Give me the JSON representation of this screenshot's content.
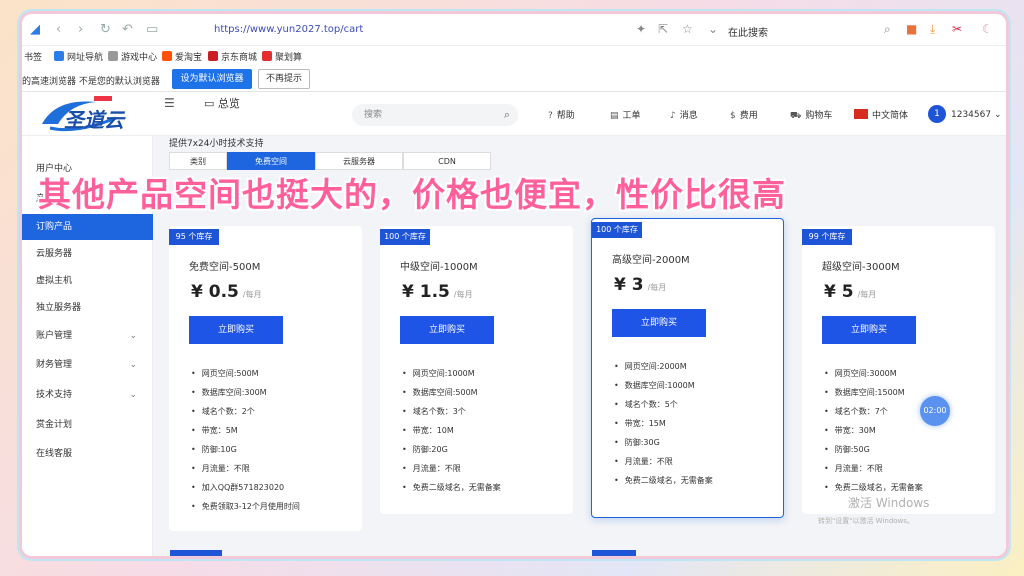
{
  "browser": {
    "url": "https://www.yun2027.top/cart",
    "search_engine_label": "在此搜索"
  },
  "bookmarks": [
    {
      "label": "书签",
      "color": "#ffffff"
    },
    {
      "label": "网址导航",
      "color": "#2b7de9"
    },
    {
      "label": "游戏中心",
      "color": "#999999"
    },
    {
      "label": "爱淘宝",
      "color": "#ff5000"
    },
    {
      "label": "京东商城",
      "color": "#c71f26"
    },
    {
      "label": "聚划算",
      "color": "#e52e2e"
    }
  ],
  "notice": {
    "text": "的高速浏览器 不是您的默认浏览器",
    "set_default_label": "设为默认浏览器",
    "no_ask_label": "不再提示"
  },
  "header": {
    "logo_text": "圣道云",
    "overview_label": "总览",
    "search_placeholder": "搜索",
    "nav": [
      {
        "icon": "?",
        "label": "帮助"
      },
      {
        "icon": "▤",
        "label": "工单"
      },
      {
        "icon": "♪",
        "label": "消息"
      },
      {
        "icon": "$",
        "label": "费用"
      },
      {
        "icon": "⛟",
        "label": "购物车"
      }
    ],
    "language": "中文简体",
    "user_badge": "1",
    "user_id": "1234567"
  },
  "sidebar": {
    "items": [
      {
        "label": "用户中心",
        "active": false,
        "caret": false
      },
      {
        "label": "产品",
        "active": false,
        "caret": false
      },
      {
        "label": "订购产品",
        "active": true,
        "caret": false
      },
      {
        "label": "云服务器",
        "active": false,
        "caret": false
      },
      {
        "label": "虚拟主机",
        "active": false,
        "caret": false
      },
      {
        "label": "独立服务器",
        "active": false,
        "caret": false
      },
      {
        "label": "账户管理",
        "active": false,
        "caret": true
      },
      {
        "label": "财务管理",
        "active": false,
        "caret": true
      },
      {
        "label": "技术支持",
        "active": false,
        "caret": true
      },
      {
        "label": "赏金计划",
        "active": false,
        "caret": false
      },
      {
        "label": "在线客服",
        "active": false,
        "caret": false
      }
    ]
  },
  "content": {
    "support_text": "提供7x24小时技术支持",
    "tabs": [
      {
        "label": "类别",
        "active": false
      },
      {
        "label": "免费空间",
        "active": true
      },
      {
        "label": "云服务器",
        "active": false
      },
      {
        "label": "CDN",
        "active": false
      }
    ],
    "products": [
      {
        "stock": "95 个库存",
        "name": "免费空间-500M",
        "currency": "¥",
        "price": "0.5",
        "unit": "/每月",
        "buy_label": "立即购买",
        "featured": false,
        "features": [
          "网页空间:500M",
          "数据库空间:300M",
          "域名个数：2个",
          "带宽：5M",
          "防御:10G",
          "月流量：不限",
          "加入QQ群571823020",
          "免费领取3-12个月使用时间"
        ]
      },
      {
        "stock": "100 个库存",
        "name": "中级空间-1000M",
        "currency": "¥",
        "price": "1.5",
        "unit": "/每月",
        "buy_label": "立即购买",
        "featured": false,
        "features": [
          "网页空间:1000M",
          "数据库空间:500M",
          "域名个数：3个",
          "带宽：10M",
          "防御:20G",
          "月流量：不限",
          "免费二级域名，无需备案"
        ]
      },
      {
        "stock": "100 个库存",
        "name": "高级空间-2000M",
        "currency": "¥",
        "price": "3",
        "unit": "/每月",
        "buy_label": "立即购买",
        "featured": true,
        "features": [
          "网页空间:2000M",
          "数据库空间:1000M",
          "域名个数：5个",
          "带宽：15M",
          "防御:30G",
          "月流量：不限",
          "免费二级域名，无需备案"
        ]
      },
      {
        "stock": "99 个库存",
        "name": "超级空间-3000M",
        "currency": "¥",
        "price": "5",
        "unit": "/每月",
        "buy_label": "立即购买",
        "featured": false,
        "features": [
          "网页空间:3000M",
          "数据库空间:1500M",
          "域名个数：7个",
          "带宽：30M",
          "防御:50G",
          "月流量：不限",
          "免费二级域名，无需备案"
        ]
      }
    ]
  },
  "timer": "02:00",
  "watermark": {
    "title": "激活 Windows",
    "subtitle": "转到\"设置\"以激活 Windows。"
  },
  "caption": "其他产品空间也挺大的，价格也便宜，性价比很高",
  "colors": {
    "accent": "#1e66e0",
    "caption": "#ff5f9a"
  }
}
